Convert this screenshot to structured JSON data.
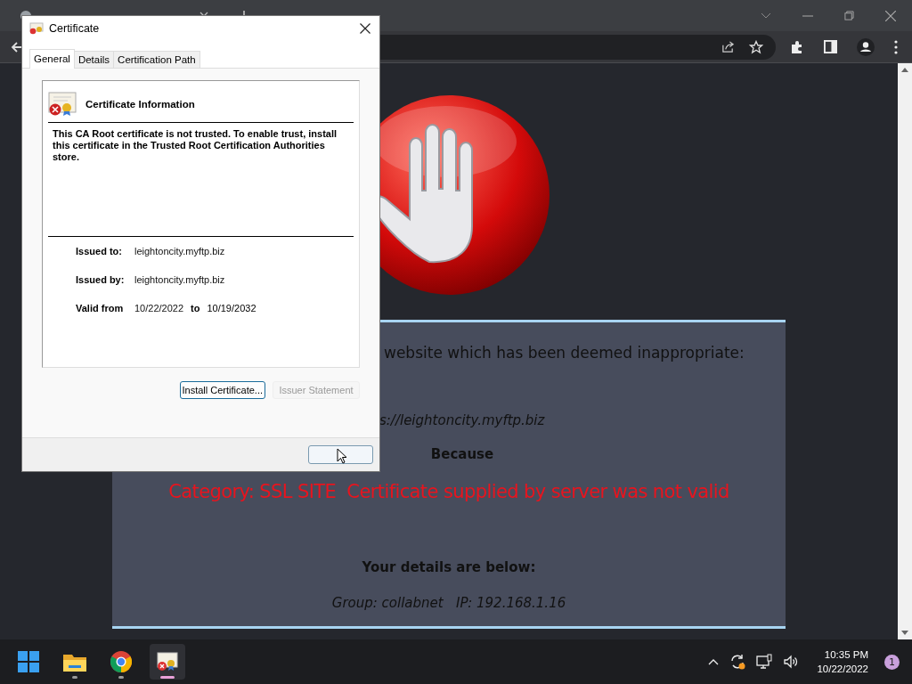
{
  "page": {
    "message": "website which has been deemed inappropriate:",
    "url": "s://leightoncity.myftp.biz",
    "because": "Because",
    "category": "Category: SSL SITE  Certificate supplied by server was not valid",
    "details_heading": "Your details are below:",
    "details": "Group: collabnet   IP: 192.168.1.16"
  },
  "dialog": {
    "title": "Certificate",
    "tabs": [
      {
        "label": "General",
        "selected": true
      },
      {
        "label": "Details",
        "selected": false
      },
      {
        "label": "Certification Path",
        "selected": false
      }
    ],
    "heading": "Certificate Information",
    "message": "This CA Root certificate is not trusted. To enable trust, install this certificate in the Trusted Root Certification Authorities store.",
    "fields": [
      {
        "label": "Issued to:",
        "value": "leightoncity.myftp.biz"
      },
      {
        "label": "Issued by:",
        "value": "leightoncity.myftp.biz"
      }
    ],
    "validity": {
      "label": "Valid from",
      "from": "10/22/2022",
      "to_label": "to",
      "to": "10/19/2032"
    },
    "buttons": [
      {
        "label": "Install Certificate...",
        "disabled": false
      },
      {
        "label": "Issuer Statement",
        "disabled": true
      }
    ]
  },
  "taskbar": {
    "apps": [
      {
        "kind": "start",
        "selected": false
      },
      {
        "kind": "folder",
        "selected": false
      },
      {
        "kind": "browser",
        "selected": false
      },
      {
        "kind": "certificate",
        "selected": true
      }
    ],
    "time": "10:35 PM",
    "date": "10/22/2022",
    "notifications": "1"
  }
}
